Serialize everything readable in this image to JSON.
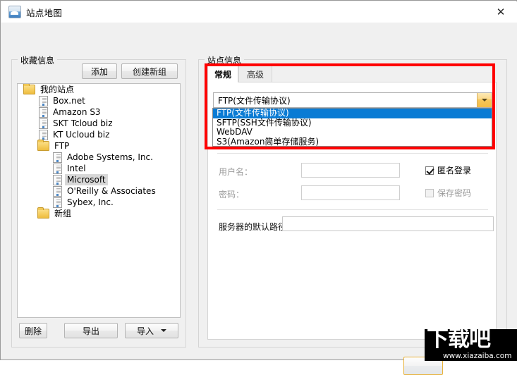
{
  "window": {
    "title": "站点地图",
    "icon": "site-map-icon",
    "close_label": "✕"
  },
  "left_panel": {
    "legend": "收藏信息",
    "buttons": {
      "add": "添加",
      "new_group": "创建新组"
    },
    "tree": [
      {
        "label": "我的站点",
        "type": "folder",
        "indent": 0,
        "selected": false
      },
      {
        "label": "Box.net",
        "type": "site",
        "indent": 1,
        "selected": false
      },
      {
        "label": "Amazon S3",
        "type": "site",
        "indent": 1,
        "selected": false
      },
      {
        "label": "SKT Tcloud biz",
        "type": "site",
        "indent": 1,
        "selected": false
      },
      {
        "label": "KT Ucloud biz",
        "type": "site",
        "indent": 1,
        "selected": false
      },
      {
        "label": "FTP",
        "type": "folder",
        "indent": 1,
        "selected": false
      },
      {
        "label": "Adobe Systems, Inc.",
        "type": "site",
        "indent": 2,
        "selected": false
      },
      {
        "label": "Intel",
        "type": "site",
        "indent": 2,
        "selected": false
      },
      {
        "label": "Microsoft",
        "type": "site",
        "indent": 2,
        "selected": true
      },
      {
        "label": "O'Reilly & Associates",
        "type": "site",
        "indent": 2,
        "selected": false
      },
      {
        "label": "Sybex, Inc.",
        "type": "site",
        "indent": 2,
        "selected": false
      },
      {
        "label": "新组",
        "type": "folder",
        "indent": 1,
        "selected": false
      }
    ],
    "footer_buttons": {
      "delete": "删除",
      "export": "导出",
      "import": "导入"
    }
  },
  "right_panel": {
    "legend": "站点信息",
    "tabs": [
      {
        "label": "常规",
        "active": true
      },
      {
        "label": "高级",
        "active": false
      }
    ],
    "protocol_combo": {
      "selected": "FTP(文件传输协议)",
      "expanded": true,
      "options": [
        {
          "label": "FTP(文件传输协议)",
          "highlighted": true
        },
        {
          "label": "SFTP(SSH文件传输协议)",
          "highlighted": false
        },
        {
          "label": "WebDAV",
          "highlighted": false
        },
        {
          "label": "S3(Amazon简单存储服务)",
          "highlighted": false
        }
      ]
    },
    "fields": {
      "username_label": "用户名：",
      "username_value": "",
      "password_label": "密码：",
      "password_value": "",
      "default_path_label": "服务器的默认路径",
      "default_path_value": ""
    },
    "checkboxes": {
      "anonymous_label": "匿名登录",
      "anonymous_checked": true,
      "save_password_label": "保存密码",
      "save_password_checked": false,
      "save_password_disabled": true
    }
  },
  "annotation": {
    "highlight_color": "#ff0000"
  },
  "watermark": {
    "text": "下载吧",
    "url": "www.xiazaiba.com"
  }
}
